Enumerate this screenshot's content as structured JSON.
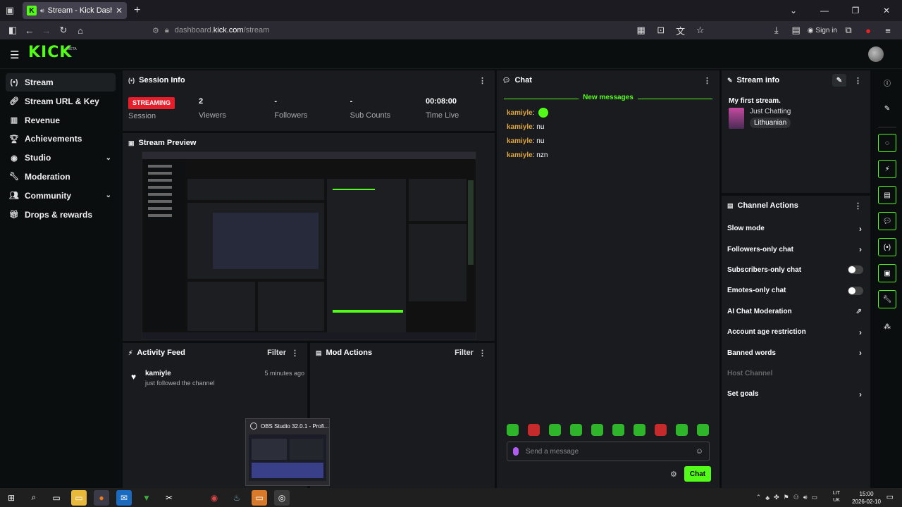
{
  "browser": {
    "tab_title": "Stream - Kick Dashboard",
    "url_host": "dashboard.kick.com",
    "url_path": "/stream",
    "url_prefix": "dashboard.",
    "signin_label": "Sign in"
  },
  "header": {
    "logo": "KICK",
    "logo_beta": "BETA"
  },
  "sidebar": {
    "items": [
      {
        "label": "Stream",
        "icon": "stream-icon"
      },
      {
        "label": "Stream URL & Key",
        "icon": "link-icon"
      },
      {
        "label": "Revenue",
        "icon": "chart-icon"
      },
      {
        "label": "Achievements",
        "icon": "trophy-icon"
      },
      {
        "label": "Studio",
        "icon": "palette-icon"
      },
      {
        "label": "Moderation",
        "icon": "wrench-icon"
      },
      {
        "label": "Community",
        "icon": "people-icon"
      },
      {
        "label": "Drops & rewards",
        "icon": "gift-icon"
      }
    ]
  },
  "session": {
    "title": "Session Info",
    "status_badge": "STREAMING",
    "session_label": "Session",
    "viewers_value": "2",
    "viewers_label": "Viewers",
    "followers_value": "-",
    "followers_label": "Followers",
    "subs_value": "-",
    "subs_label": "Sub Counts",
    "time_value": "00:08:00",
    "time_label": "Time Live"
  },
  "preview": {
    "title": "Stream Preview"
  },
  "chat": {
    "title": "Chat",
    "new_messages": "New messages",
    "messages": [
      {
        "user": "kamiyle",
        "text": ""
      },
      {
        "user": "kamiyle",
        "text": "nu"
      },
      {
        "user": "kamiyle",
        "text": "nu"
      },
      {
        "user": "kamiyle",
        "text": "nzn"
      }
    ],
    "input_placeholder": "Send a message",
    "send_label": "Chat"
  },
  "stream_info": {
    "title": "Stream info",
    "stream_title": "My first stream.",
    "category": "Just Chatting",
    "tag": "Lithuanian"
  },
  "channel_actions": {
    "title": "Channel Actions",
    "items": [
      {
        "label": "Slow mode",
        "control": "chevron"
      },
      {
        "label": "Followers-only chat",
        "control": "chevron"
      },
      {
        "label": "Subscribers-only chat",
        "control": "toggle"
      },
      {
        "label": "Emotes-only chat",
        "control": "toggle"
      },
      {
        "label": "AI Chat Moderation",
        "control": "external"
      },
      {
        "label": "Account age restriction",
        "control": "chevron"
      },
      {
        "label": "Banned words",
        "control": "chevron"
      },
      {
        "label": "Host Channel",
        "control": "none"
      },
      {
        "label": "Set goals",
        "control": "chevron"
      }
    ]
  },
  "activity_feed": {
    "title": "Activity Feed",
    "filter_label": "Filter",
    "entries": [
      {
        "user": "kamiyle",
        "text": "just followed the channel",
        "time": "5 minutes ago"
      }
    ]
  },
  "mod_actions": {
    "title": "Mod Actions",
    "filter_label": "Filter"
  },
  "obs_popup": {
    "title": "OBS Studio 32.0.1 - Profi..."
  },
  "taskbar": {
    "lang_top": "LIT",
    "lang_bottom": "UK",
    "time": "15:00",
    "date": "2026-02-10"
  },
  "colors": {
    "kick_green": "#53fc18",
    "streaming_red": "#e61d2b",
    "chat_username": "#e0a53a",
    "panel_bg": "#191b1f"
  }
}
